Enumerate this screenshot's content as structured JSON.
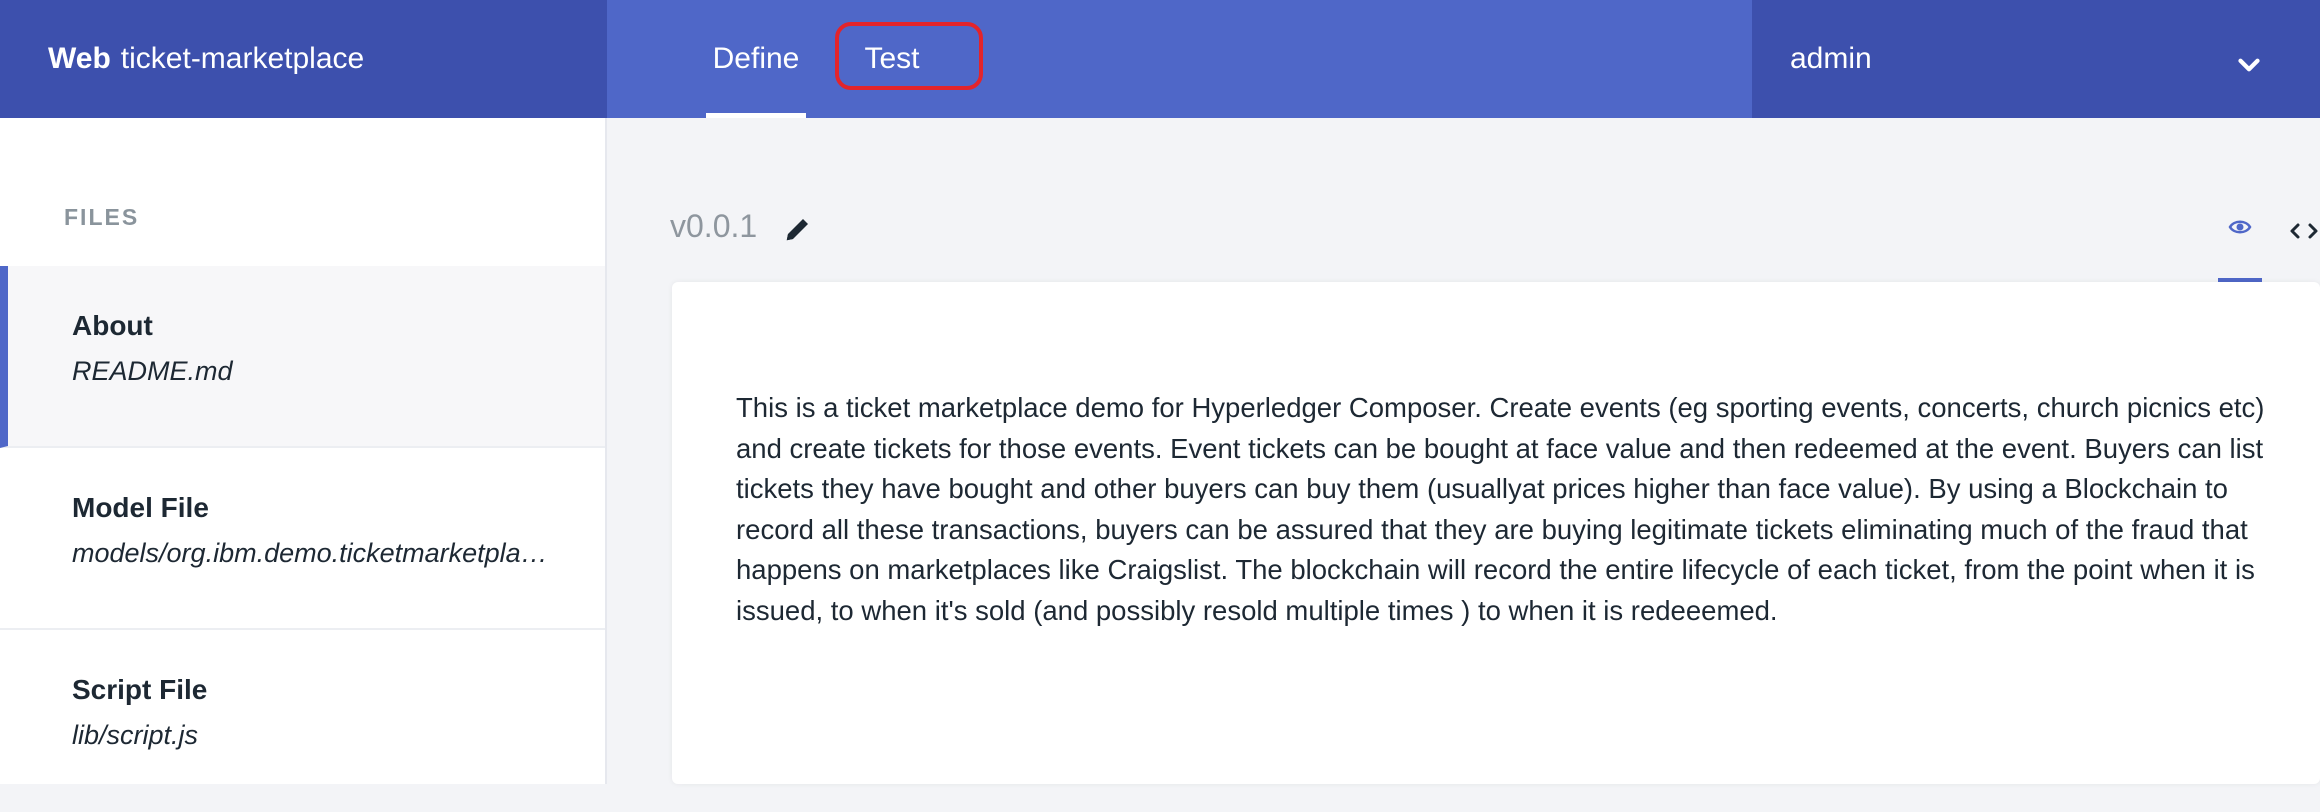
{
  "header": {
    "brand_strong": "Web",
    "brand_name": "ticket-marketplace",
    "tabs": [
      {
        "label": "Define",
        "active": true
      },
      {
        "label": "Test",
        "active": false,
        "highlighted": true
      }
    ],
    "user": "admin",
    "user_menu_icon": "chevron-down-icon"
  },
  "sidebar": {
    "section_label": "FILES",
    "files": [
      {
        "title": "About",
        "path": "README.md",
        "active": true
      },
      {
        "title": "Model File",
        "path": "models/org.ibm.demo.ticketmarketplace.cto",
        "active": false
      },
      {
        "title": "Script File",
        "path": "lib/script.js",
        "active": false
      }
    ]
  },
  "main": {
    "version": "v0.0.1",
    "edit_icon": "pencil-icon",
    "view_toggle": [
      {
        "icon": "eye-icon",
        "active": true
      },
      {
        "icon": "code-icon",
        "active": false
      }
    ],
    "readme": "This is a ticket marketplace demo for Hyperledger Composer. Create events (eg sporting events, concerts, church picnics etc) and create tickets for those events. Event tickets can be bought at face value and then redeemed at the event. Buyers can list tickets they have bought and other buyers can buy them (usuallyat prices higher than face value). By using a Blockchain to record all these transactions, buyers can be assured that they are buying legitimate tickets eliminating much of the fraud that happens on marketplaces like Craigslist. The blockchain will record the entire lifecycle of each ticket, from the point when it is issued, to when it's sold (and possibly resold multiple times ) to when it is redeeemed."
  },
  "colors": {
    "header_bg": "#4f67c8",
    "header_dark": "#3d50ad",
    "accent": "#4f67c8",
    "highlight": "#e3242b"
  }
}
